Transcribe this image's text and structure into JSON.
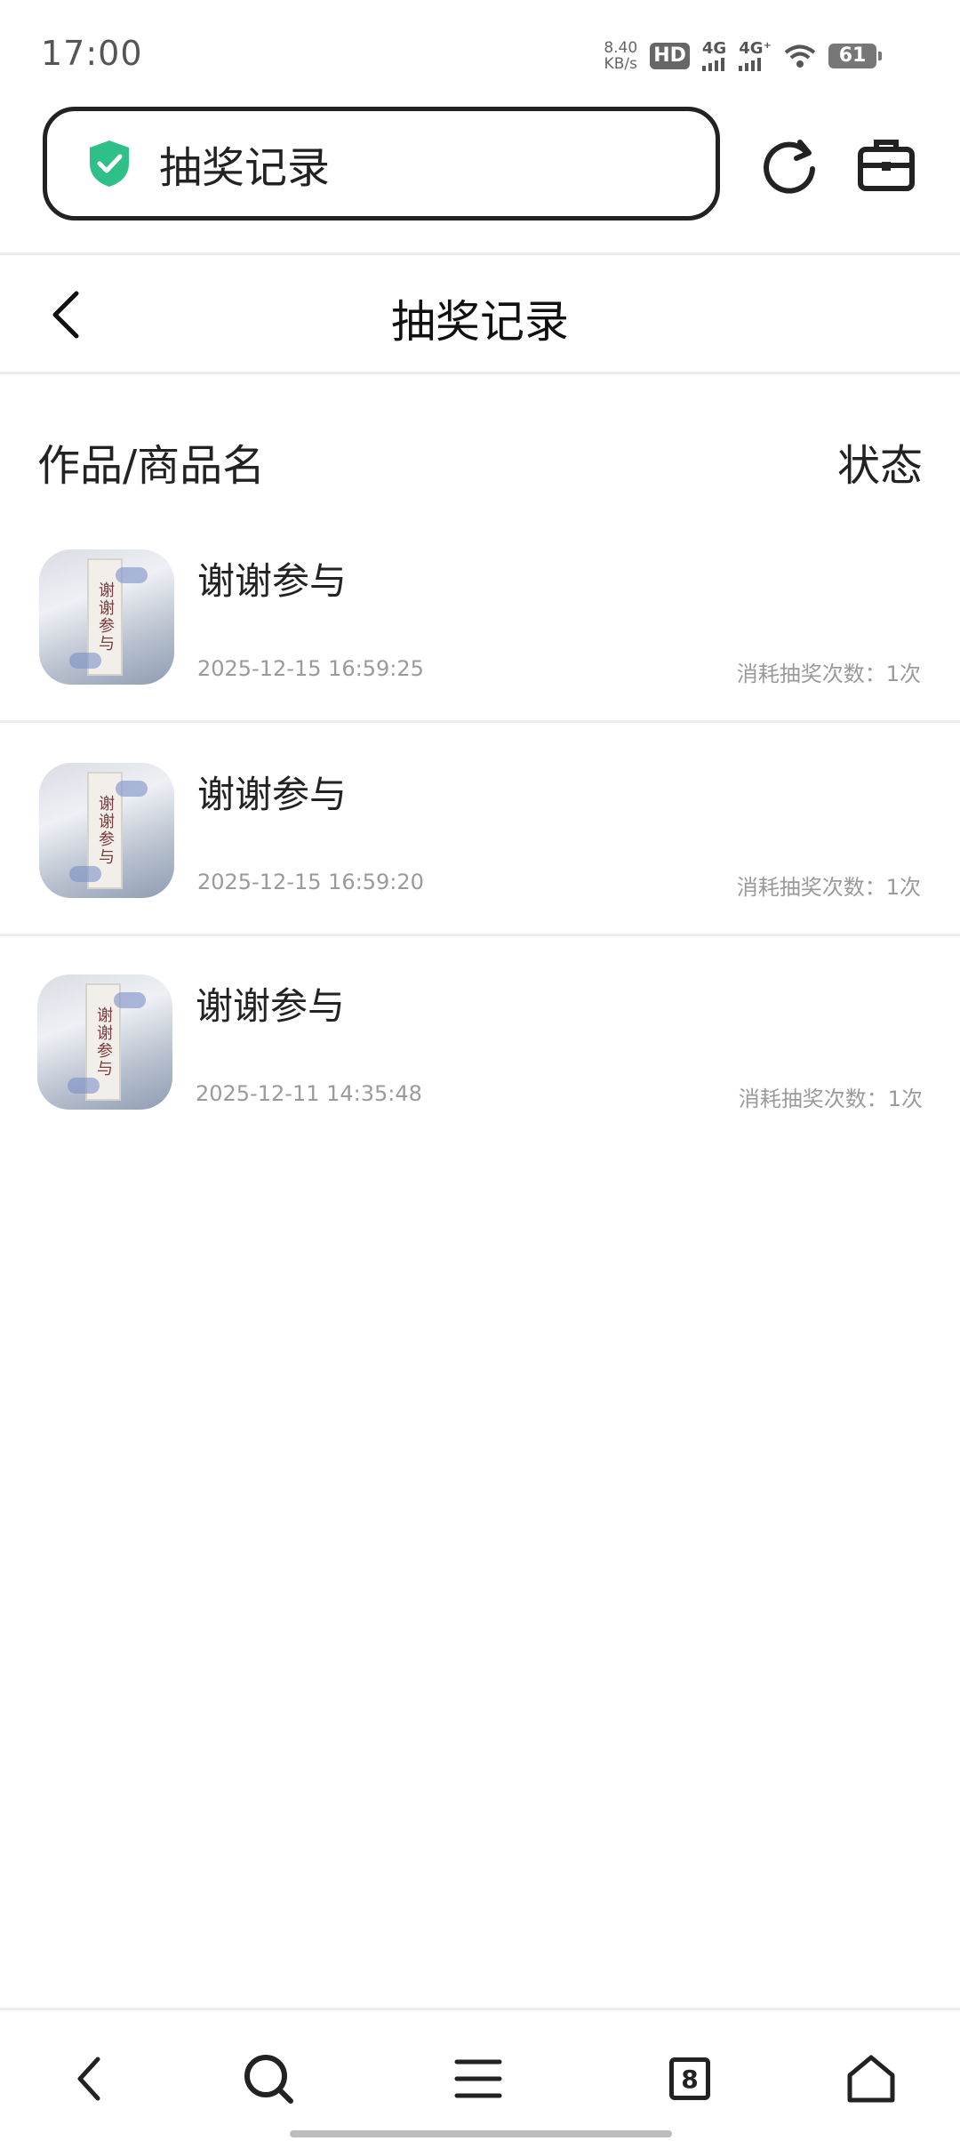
{
  "status_bar": {
    "time": "17:00",
    "speed_value": "8.40",
    "speed_unit": "KB/s",
    "hd_label": "HD",
    "sim1_label": "4G",
    "sim2_label": "4G⁺",
    "battery": "61"
  },
  "address_bar": {
    "text": "抽奖记录",
    "shield_icon": "shield-check-icon",
    "shield_color": "#2fc08a"
  },
  "header": {
    "title": "抽奖记录",
    "back_icon": "chevron-left-icon"
  },
  "list_header": {
    "name_col": "作品/商品名",
    "status_col": "状态"
  },
  "records": [
    {
      "title": "谢谢参与",
      "date": "2025-12-15 16:59:25",
      "cost": "消耗抽奖次数：1次",
      "thumb_text": "谢谢参与"
    },
    {
      "title": "谢谢参与",
      "date": "2025-12-15 16:59:20",
      "cost": "消耗抽奖次数：1次",
      "thumb_text": "谢谢参与"
    },
    {
      "title": "谢谢参与",
      "date": "2025-12-11 14:35:48",
      "cost": "消耗抽奖次数：1次",
      "thumb_text": "谢谢参与"
    }
  ],
  "bottom_nav": {
    "back_icon": "chevron-left-icon",
    "search_icon": "search-icon",
    "menu_icon": "menu-icon",
    "tabs_count": "8",
    "home_icon": "home-icon"
  }
}
